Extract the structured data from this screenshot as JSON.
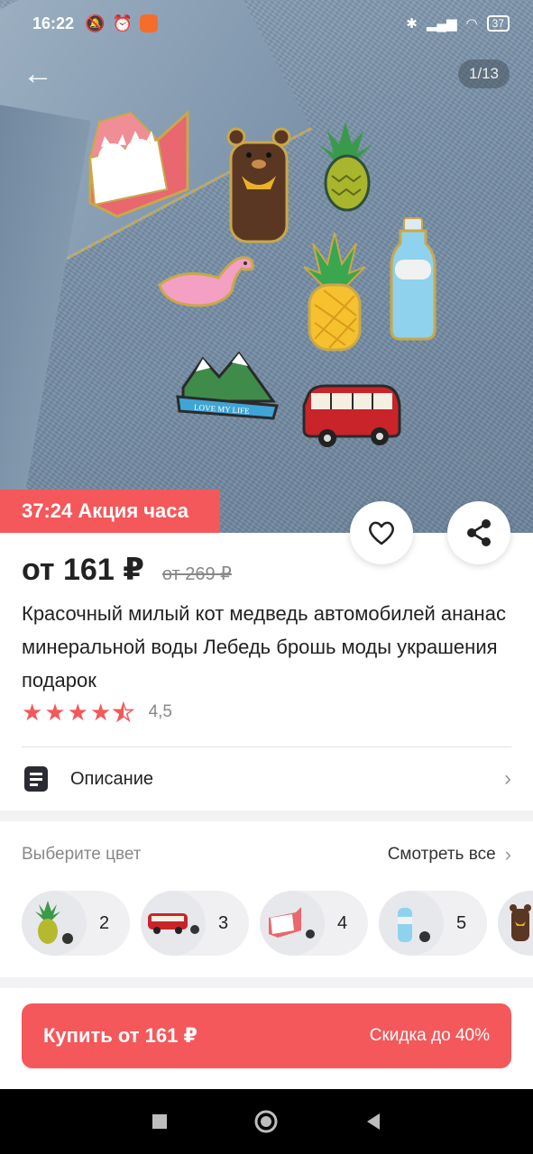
{
  "status_bar": {
    "time": "16:22",
    "battery": "37"
  },
  "gallery": {
    "counter": "1/13",
    "pin_text": "LOVE MY LIFE"
  },
  "promo": {
    "label": "37:24 Акция часа"
  },
  "product": {
    "price": "от 161 ₽",
    "old_price": "от 269 ₽",
    "title": "Красочный милый кот медведь автомобилей ананас минеральной воды Лебедь брошь моды украшения подарок",
    "rating": 4.5,
    "rating_label": "4,5"
  },
  "description": {
    "label": "Описание"
  },
  "colors": {
    "label": "Выберите цвет",
    "see_all": "Смотреть все",
    "options": [
      {
        "icon": "pineapple-pin-icon",
        "count": "2"
      },
      {
        "icon": "bus-pin-icon",
        "count": "3"
      },
      {
        "icon": "cat-box-pin-icon",
        "count": "4"
      },
      {
        "icon": "water-bottle-pin-icon",
        "count": "5"
      },
      {
        "icon": "bear-pin-icon",
        "count": ""
      }
    ]
  },
  "buy": {
    "label": "Купить от 161 ₽",
    "discount": "Скидка до 40%"
  },
  "colors_accent": {
    "brand": "#f4585a"
  }
}
